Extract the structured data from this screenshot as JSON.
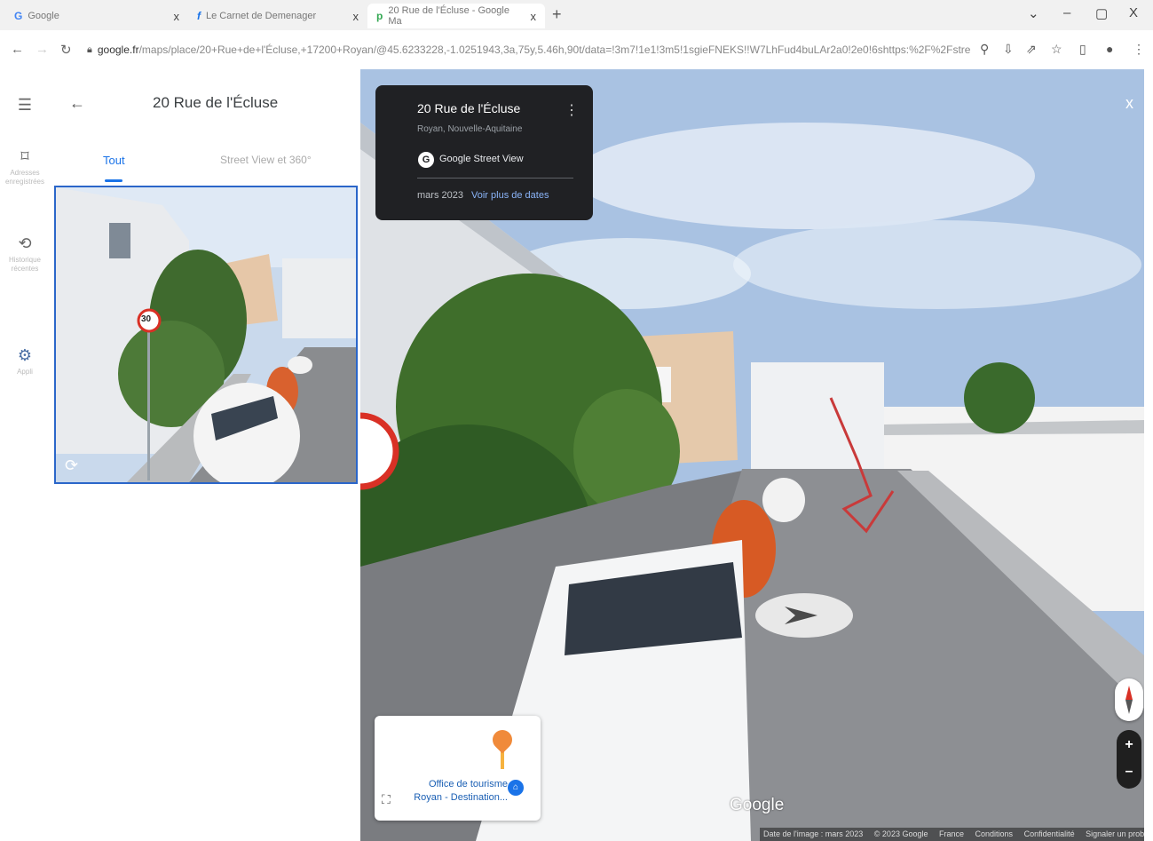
{
  "browser": {
    "tabs": [
      {
        "favicon": "G",
        "title": "Google",
        "close": "x"
      },
      {
        "favicon": "f",
        "title": "Le Carnet de Demenager",
        "close": "x"
      },
      {
        "favicon": "p",
        "title": "20 Rue de l'Écluse - Google Ma",
        "close": "x"
      }
    ],
    "new_tab": "+",
    "window_controls": [
      "⌄",
      "–",
      "▢",
      "X"
    ],
    "url_host": "google.fr",
    "url_rest": "/maps/place/20+Rue+de+l'Écluse,+17200+Royan/@45.6233228,-1.0251943,3a,75y,5.46h,90t/data=!3m7!1e1!3m5!1sgieFNEKS!!W7LhFud4buLAr2a0!2e0!6shttps:%2F%2Fstreetview..."
  },
  "rail": {
    "items": [
      {
        "icon": "menu-icon",
        "label": ""
      },
      {
        "icon": "bookmark-icon",
        "label": "Adresses enregistrées"
      },
      {
        "icon": "history-icon",
        "label": "Historique récentes"
      },
      {
        "icon": "apps-icon",
        "label": "Appli"
      }
    ]
  },
  "panel": {
    "title": "20 Rue de l'Écluse",
    "tabs": {
      "all": "Tout",
      "street_view": "Street View et 360°"
    },
    "speed_sign": "30"
  },
  "streetview": {
    "card": {
      "title": "20 Rue de l'Écluse",
      "subtitle": "Royan, Nouvelle-Aquitaine",
      "source": "Google Street View",
      "logo_letter": "G",
      "date": "mars 2023",
      "more_dates": "Voir plus de dates",
      "menu": "⋮"
    },
    "close": "x",
    "zoom_in": "+",
    "zoom_out": "–",
    "minimap": {
      "poi_label": "Office de tourisme Royan - Destination...",
      "poi_icon_glyph": "⌂"
    },
    "google_logo": "Google",
    "attribution": [
      "Date de l'image : mars 2023",
      "© 2023 Google",
      "France",
      "Conditions",
      "Confidentialité",
      "Signaler un problème"
    ]
  },
  "colors": {
    "accent": "#1a73e8",
    "card_bg": "#202124",
    "thumb_border": "#2b66c9"
  }
}
